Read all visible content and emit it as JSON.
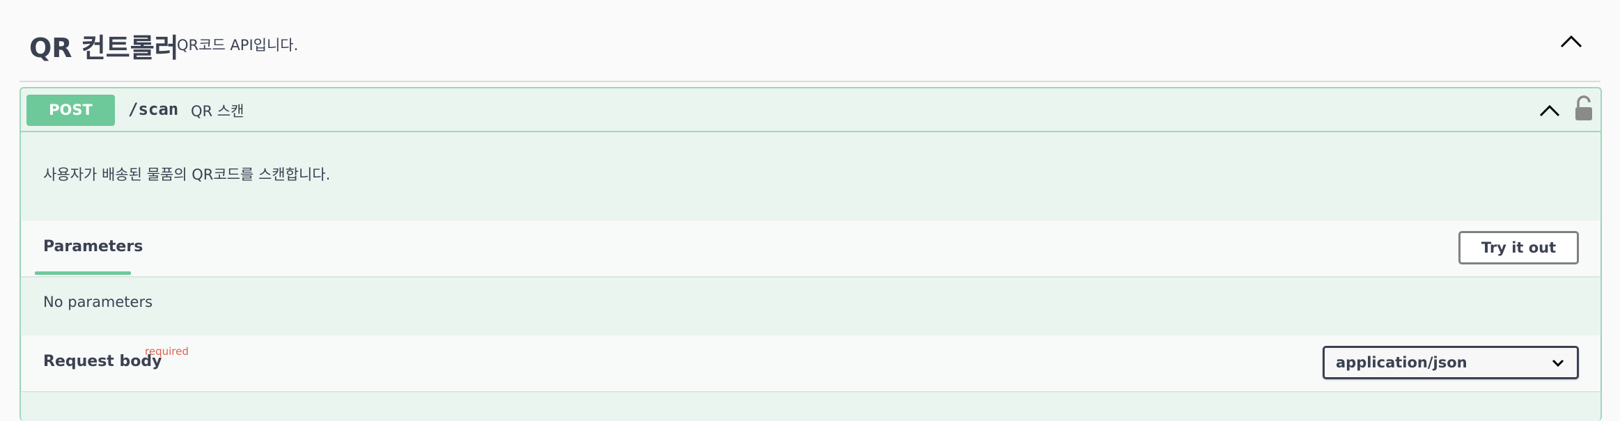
{
  "tag": {
    "title": "QR 컨트롤러",
    "description": "QR코드 API입니다.",
    "toggle_icon": "chevron-up-icon"
  },
  "operation": {
    "method": "POST",
    "path": "/scan",
    "summary": "QR 스캔",
    "description": "사용자가 배송된 물품의 QR코드를 스캔합니다.",
    "colors": {
      "method_bg": "#6ec99a",
      "block_bg": "#ebf5f0",
      "border": "#9fd7b9"
    },
    "toggle_icon": "chevron-up-icon",
    "lock_icon": "unlocked-icon"
  },
  "parameters": {
    "tab_label": "Parameters",
    "try_button": "Try it out",
    "empty_text": "No parameters"
  },
  "request_body": {
    "label": "Request body",
    "required_label": "required",
    "content_type": "application/json",
    "required_color": "#e0624f"
  }
}
